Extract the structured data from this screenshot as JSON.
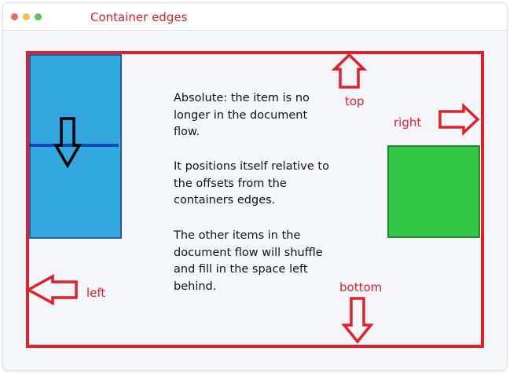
{
  "window": {
    "title": "Container edges"
  },
  "description": {
    "paragraph_1": "Absolute: the item is no longer in the document flow.",
    "paragraph_2": "It positions itself relative to the offsets from the containers edges.",
    "paragraph_3": "The other items in the document flow will shuffle and fill in the space left behind."
  },
  "edge_labels": {
    "top": "top",
    "right": "right",
    "left": "left",
    "bottom": "bottom"
  },
  "colors": {
    "window_control_close": "#ec6a5e",
    "window_control_minimize": "#f4bf4f",
    "window_control_zoom": "#61c554",
    "accent_red": "#e0212c",
    "blue_item": "#33a7df",
    "green_item": "#33c748",
    "down_arrow": "#000000"
  },
  "icons": {
    "top_arrow": "arrow-up-outline-icon",
    "right_arrow": "arrow-right-outline-icon",
    "left_arrow": "arrow-left-outline-icon",
    "bottom_arrow": "arrow-down-outline-icon",
    "item_arrow": "arrow-down-outline-icon"
  }
}
